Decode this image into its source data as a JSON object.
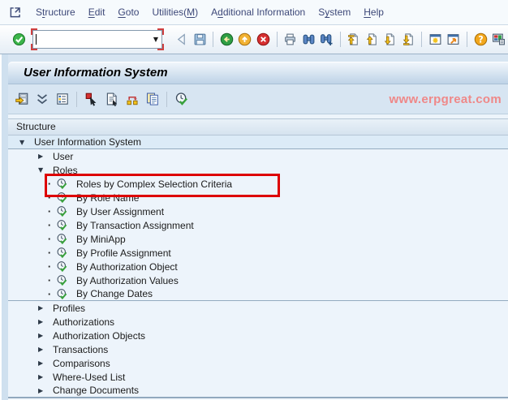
{
  "title": "User Information System",
  "watermark": "www.erpgreat.com",
  "colors": {
    "highlight_box": "#dd0000",
    "watermark": "#ef8888",
    "menu_text": "#3d4878",
    "titlebar_top": "#f2f7fc",
    "titlebar_bottom": "#bed3e7",
    "content_bg": "#edf4fb"
  },
  "menu": {
    "system_icon": "sap-system-menu-icon",
    "items": [
      {
        "label": "Structure",
        "mnemonic_index": 1
      },
      {
        "label": "Edit",
        "mnemonic_index": 0
      },
      {
        "label": "Goto",
        "mnemonic_index": 0
      },
      {
        "label": "Utilities(M)",
        "mnemonic_index": 10
      },
      {
        "label": "Additional Information",
        "mnemonic_index": 1
      },
      {
        "label": "System",
        "mnemonic_index": 1
      },
      {
        "label": "Help",
        "mnemonic_index": 0
      }
    ]
  },
  "toolbar": {
    "command_field": {
      "value": "",
      "placeholder": ""
    },
    "items": [
      "enter",
      "command-field",
      "back",
      "save",
      "|",
      "back-circle",
      "exit-circle",
      "cancel-circle",
      "|",
      "print",
      "find",
      "find-next",
      "|",
      "first-page",
      "prev-page",
      "next-page",
      "last-page",
      "|",
      "new-session",
      "create-shortcut",
      "|",
      "help",
      "customize-layout"
    ]
  },
  "app_toolbar": {
    "items": [
      "other-object",
      "collapse-all",
      "list-display",
      "|",
      "select-block",
      "doc-select",
      "sort",
      "copy",
      "|",
      "execute-clock"
    ]
  },
  "tree": {
    "header": "Structure",
    "leaf_icon": "execute-clock",
    "rows": [
      {
        "label": "User Information System",
        "level": 0,
        "type": "expanded",
        "root": true,
        "separator_below": true
      },
      {
        "label": "User",
        "level": 1,
        "type": "collapsed"
      },
      {
        "label": "Roles",
        "level": 1,
        "type": "expanded"
      },
      {
        "label": "Roles by Complex Selection Criteria",
        "level": 2,
        "type": "leaf",
        "highlighted": true
      },
      {
        "label": "By Role Name",
        "level": 2,
        "type": "leaf"
      },
      {
        "label": "By User Assignment",
        "level": 2,
        "type": "leaf"
      },
      {
        "label": "By Transaction Assignment",
        "level": 2,
        "type": "leaf"
      },
      {
        "label": "By MiniApp",
        "level": 2,
        "type": "leaf"
      },
      {
        "label": "By Profile Assignment",
        "level": 2,
        "type": "leaf"
      },
      {
        "label": "By Authorization Object",
        "level": 2,
        "type": "leaf"
      },
      {
        "label": "By Authorization Values",
        "level": 2,
        "type": "leaf"
      },
      {
        "label": "By Change Dates",
        "level": 2,
        "type": "leaf",
        "separator_below": true
      },
      {
        "label": "Profiles",
        "level": 1,
        "type": "collapsed"
      },
      {
        "label": "Authorizations",
        "level": 1,
        "type": "collapsed"
      },
      {
        "label": "Authorization Objects",
        "level": 1,
        "type": "collapsed"
      },
      {
        "label": "Transactions",
        "level": 1,
        "type": "collapsed"
      },
      {
        "label": "Comparisons",
        "level": 1,
        "type": "collapsed"
      },
      {
        "label": "Where-Used List",
        "level": 1,
        "type": "collapsed"
      },
      {
        "label": "Change Documents",
        "level": 1,
        "type": "collapsed",
        "separator_below": true
      }
    ]
  }
}
